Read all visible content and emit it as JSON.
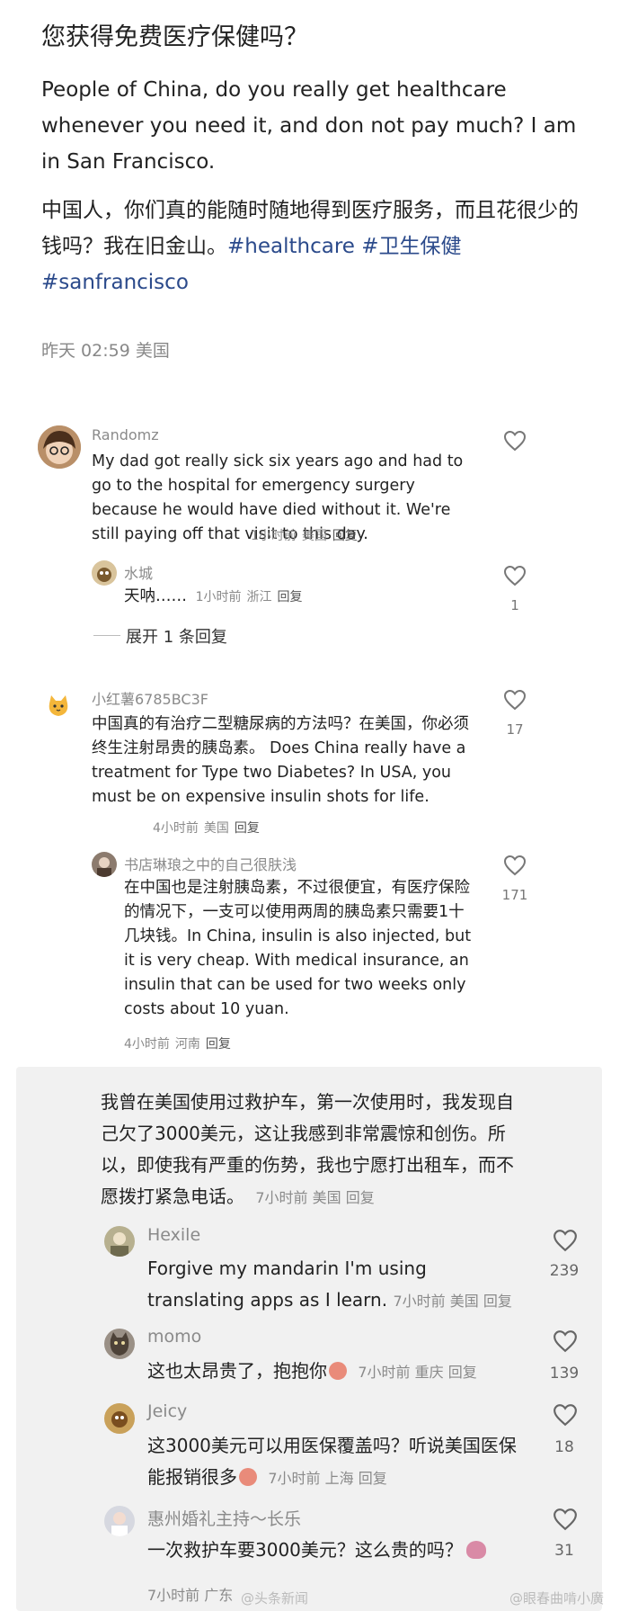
{
  "post": {
    "title": "您获得免费医疗保健吗？",
    "en": "People of China, do you really get healthcare whenever you need it, and don not pay much?  I am in San Francisco.",
    "cn_text": "中国人，你们真的能随时随地得到医疗服务，而且花很少的钱吗？我在旧金山。",
    "tag1": "#healthcare",
    "tag2": "#卫生保健",
    "tag3": "#sanfrancisco",
    "meta": "昨天 02:59 美国"
  },
  "comments": [
    {
      "user": "Randomz",
      "text": "My dad got really sick six years ago and had to go to the hospital for emergency surgery because he would have died without it. We're still paying off that visit to this day.",
      "time": "1小时前",
      "loc": "美国",
      "reply": "回复",
      "replies": [
        {
          "user": "水城",
          "text": "天呐……",
          "time": "1小时前",
          "loc": "浙江",
          "reply": "回复",
          "likes": "1"
        }
      ],
      "expand": "展开 1 条回复"
    },
    {
      "user": "小红薯6785BC3F",
      "text": "中国真的有治疗二型糖尿病的方法吗？在美国，你必须终生注射昂贵的胰岛素。 Does China really have a treatment for Type two Diabetes?  In USA, you must be on expensive insulin shots for life.",
      "time": "4小时前",
      "loc": "美国",
      "reply": "回复",
      "likes": "17",
      "replies": [
        {
          "user": "书店琳琅之中的自己很肤浅",
          "text": "在中国也是注射胰岛素，不过很便宜，有医疗保险的情况下，一支可以使用两周的胰岛素只需要1十几块钱。In China, insulin is also injected, but it is very cheap. With medical insurance, an insulin that can be used for two weeks only costs about 10 yuan.",
          "time": "4小时前",
          "loc": "河南",
          "reply": "回复",
          "likes": "171"
        }
      ]
    }
  ],
  "panel": {
    "main_text": "我曾在美国使用过救护车，第一次使用时，我发现自己欠了3000美元，这让我感到非常震惊和创伤。所以，即使我有严重的伤势，我也宁愿打出租车，而不愿拨打紧急电话。",
    "main_time": "7小时前",
    "main_loc": "美国",
    "main_reply": "回复",
    "replies": [
      {
        "user": "Hexile",
        "text": "Forgive my mandarin I'm using translating apps as I learn.",
        "time": "7小时前",
        "loc": "美国",
        "reply": "回复",
        "likes": "239"
      },
      {
        "user": "momo",
        "text": "这也太昂贵了，抱抱你",
        "time": "7小时前",
        "loc": "重庆",
        "reply": "回复",
        "likes": "139"
      },
      {
        "user": "Jeicy",
        "text": "这3000美元可以用医保覆盖吗？听说美国医保能报销很多",
        "time": "7小时前",
        "loc": "上海",
        "reply": "回复",
        "likes": "18"
      },
      {
        "user": "惠州婚礼主持～长乐",
        "text": "一次救护车要3000美元？这么贵的吗？",
        "time": "7小时前",
        "loc": "广东",
        "reply": "",
        "likes": "31"
      }
    ]
  },
  "watermarks": {
    "left": "@头条新闻",
    "right": "@眼春曲啃小廣"
  },
  "icons": {
    "like": "heart-outline-icon"
  }
}
